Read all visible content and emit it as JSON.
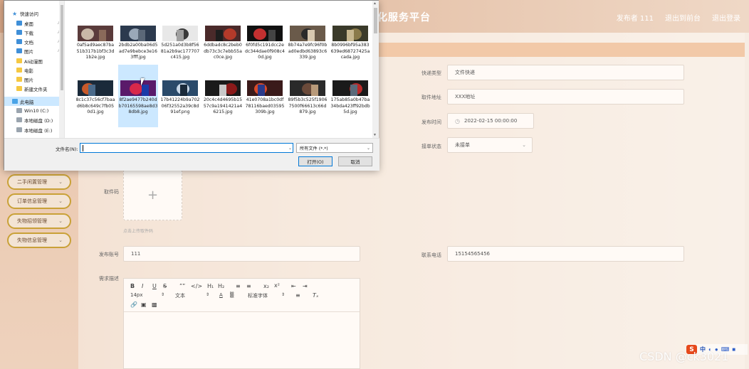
{
  "app": {
    "title": "化服务平台",
    "header_links": [
      "发布者 111",
      "退出到前台",
      "退出登录"
    ]
  },
  "sidebar": {
    "menu": [
      {
        "label": "二手闲置管理"
      },
      {
        "label": "订单信息管理"
      },
      {
        "label": "失物招领管理"
      },
      {
        "label": "失物信息管理"
      }
    ]
  },
  "form": {
    "express_type_label": "快递类型",
    "express_type_value": "文件快递",
    "pickup_address_label": "取件地址",
    "pickup_address_value": "XXX地址",
    "publish_time_label": "发布时间",
    "publish_time_value": "2022-02-15 00:00:00",
    "order_status_label": "接单状态",
    "order_status_value": "未接单",
    "pickup_code_label": "取件码",
    "upload_hint": "点击上传取件码",
    "publisher_account_label": "发布账号",
    "publisher_account_value": "111",
    "phone_label": "联系电话",
    "phone_value": "15154565456",
    "description_label": "需求描述",
    "editor": {
      "font_size": "14px",
      "paragraph": "文本",
      "font_family": "标准字体"
    }
  },
  "dialog": {
    "nav": [
      {
        "label": "快速访问",
        "icon": "star-icon"
      },
      {
        "label": "桌面",
        "icon": "desktop-icon",
        "pinned": true
      },
      {
        "label": "下载",
        "icon": "download-icon",
        "pinned": true
      },
      {
        "label": "文档",
        "icon": "document-icon",
        "pinned": true
      },
      {
        "label": "图片",
        "icon": "picture-icon",
        "pinned": true
      },
      {
        "label": "AI动漫图",
        "icon": "folder-icon"
      },
      {
        "label": "电影",
        "icon": "folder-icon"
      },
      {
        "label": "图片",
        "icon": "folder-icon"
      },
      {
        "label": "新建文件夹",
        "icon": "folder-icon"
      },
      {
        "label": "此电脑",
        "icon": "computer-icon",
        "selected": true
      },
      {
        "label": "Win10 (C:)",
        "icon": "drive-icon"
      },
      {
        "label": "本地磁盘 (D:)",
        "icon": "drive-icon"
      },
      {
        "label": "本地磁盘 (E:)",
        "icon": "drive-icon"
      }
    ],
    "files": [
      {
        "name": "0af5ad9aec87ba51b317b1bf3c3d1b2e.jpg"
      },
      {
        "name": "2bdb2a00ba06d5ad7e9bebce3e163fff.jpg"
      },
      {
        "name": "5d251a0d3b8f5681a2b9ac177707c415.jpg"
      },
      {
        "name": "6ddbadc8c2beb0db73c3c7ebb55ac0ce.jpg"
      },
      {
        "name": "6f0fd5c191dcc2edc344dae0f908c40d.jpg"
      },
      {
        "name": "8b74a7e9fc96f0bad0edbd63893c6339.jpg"
      },
      {
        "name": "8b0996bf95a383639ed68727425acada.jpg"
      },
      {
        "name": "8c1c37c56cf7baad6b8c649c7fb050d1.jpg"
      },
      {
        "name": "8f2ae9477b240db70165598ae8d38db8.jpg",
        "selected": true
      },
      {
        "name": "17b41224b9a70206f32552a39c8d91ef.png"
      },
      {
        "name": "20c4c4d4695b1557c9a1941421a46215.jpg"
      },
      {
        "name": "41e0708a1bc0df78116baed03595309b.jpg"
      },
      {
        "name": "89f5b3c525f19067500f66613c66d879.jpg"
      },
      {
        "name": "175ab85a0b47ba34bda423ff92bdb5d.jpg"
      }
    ],
    "filename_label": "文件名(N):",
    "filename_value": "",
    "filetype_value": "所有文件 (*.*)",
    "open_button": "打开(O)",
    "cancel_button": "取消"
  },
  "overlay": {
    "watermark": "CSDN @ck3021",
    "ime_logo": "S",
    "ime_text": "中"
  }
}
